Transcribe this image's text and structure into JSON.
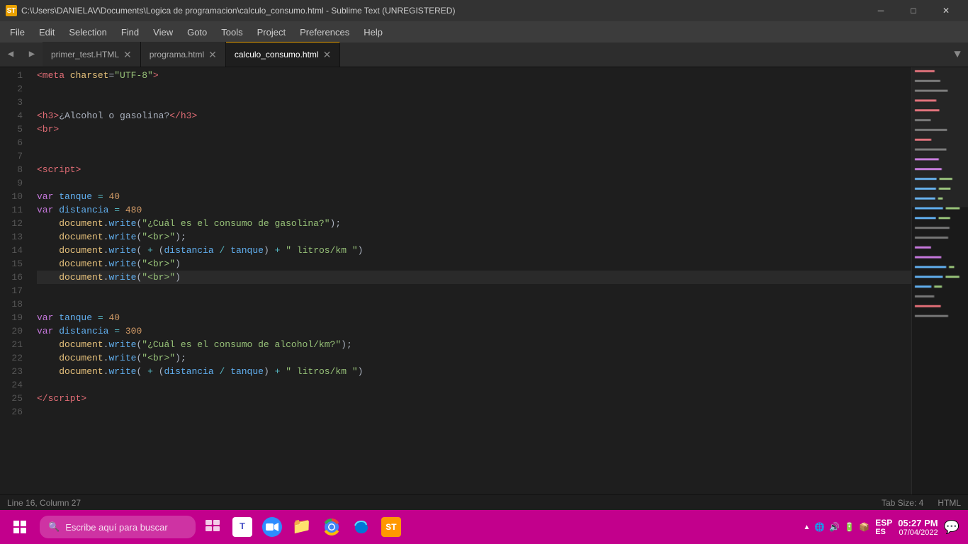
{
  "titlebar": {
    "icon": "ST",
    "title": "C:\\Users\\DANIELAV\\Documents\\Logica de programacion\\calculo_consumo.html - Sublime Text (UNREGISTERED)",
    "minimize": "─",
    "maximize": "□",
    "close": "✕"
  },
  "menubar": {
    "items": [
      "File",
      "Edit",
      "Selection",
      "Find",
      "View",
      "Goto",
      "Tools",
      "Project",
      "Preferences",
      "Help"
    ]
  },
  "tabs": [
    {
      "label": "primer_test.HTML",
      "active": false
    },
    {
      "label": "programa.html",
      "active": false
    },
    {
      "label": "calculo_consumo.html",
      "active": true
    }
  ],
  "statusbar": {
    "position": "Line 16, Column 27",
    "tab_size": "Tab Size: 4",
    "syntax": "HTML"
  },
  "taskbar": {
    "search_placeholder": "Escribe aquí para buscar",
    "lang": "ESP\nES",
    "time": "05:27 PM",
    "date": "07/04/2022"
  },
  "lines": 26
}
